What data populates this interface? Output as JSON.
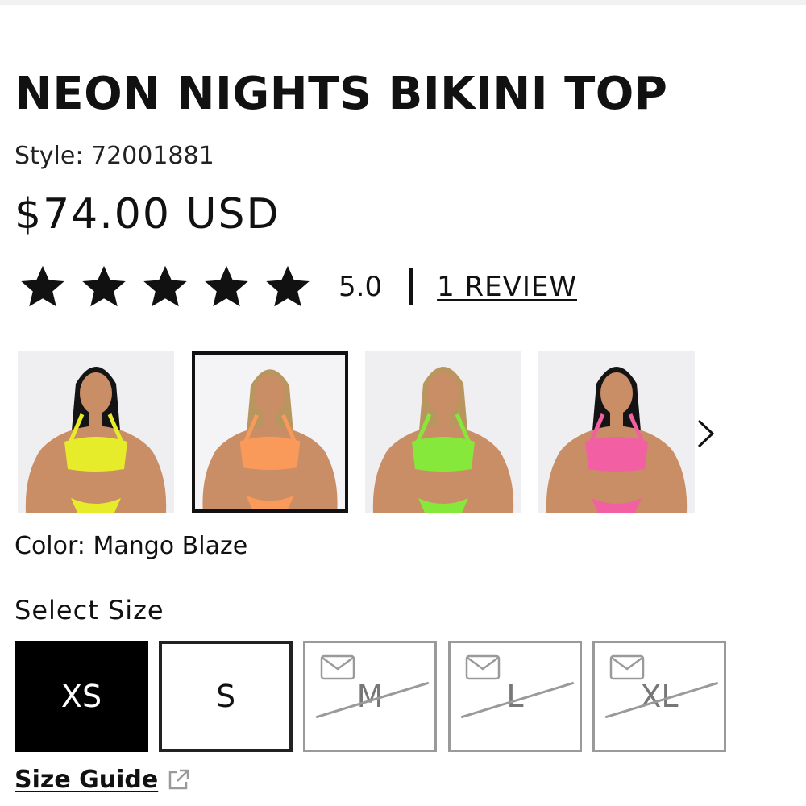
{
  "product": {
    "title": "NEON NIGHTS BIKINI TOP",
    "style_label": "Style: 72001881",
    "price": "$74.00 USD",
    "rating": {
      "stars": 5,
      "value": "5.0",
      "separator": "|",
      "reviews_link": "1 REVIEW"
    },
    "gallery": {
      "thumbnails": [
        {
          "color_name": "yellow",
          "swatch": "#e7ec2a",
          "hair": "#141414"
        },
        {
          "color_name": "orange",
          "swatch": "#f99a5a",
          "hair": "#b9955f",
          "selected": true
        },
        {
          "color_name": "green",
          "swatch": "#86e83a",
          "hair": "#b9955f"
        },
        {
          "color_name": "pink",
          "swatch": "#f25fa3",
          "hair": "#141414"
        }
      ],
      "next_icon": "chevron-right-icon"
    },
    "color_label": "Color: Mango Blaze",
    "size_heading": "Select Size",
    "sizes": [
      {
        "label": "XS",
        "state": "selected"
      },
      {
        "label": "S",
        "state": "available"
      },
      {
        "label": "M",
        "state": "sold-out"
      },
      {
        "label": "L",
        "state": "sold-out"
      },
      {
        "label": "XL",
        "state": "sold-out"
      }
    ],
    "size_guide": {
      "label": "Size Guide",
      "icon": "external-link-icon"
    }
  },
  "colors": {
    "text": "#111111",
    "soldout_gray": "#9a9a9a",
    "thumb_bg": "#efeff1",
    "skin": "#c98e66"
  }
}
